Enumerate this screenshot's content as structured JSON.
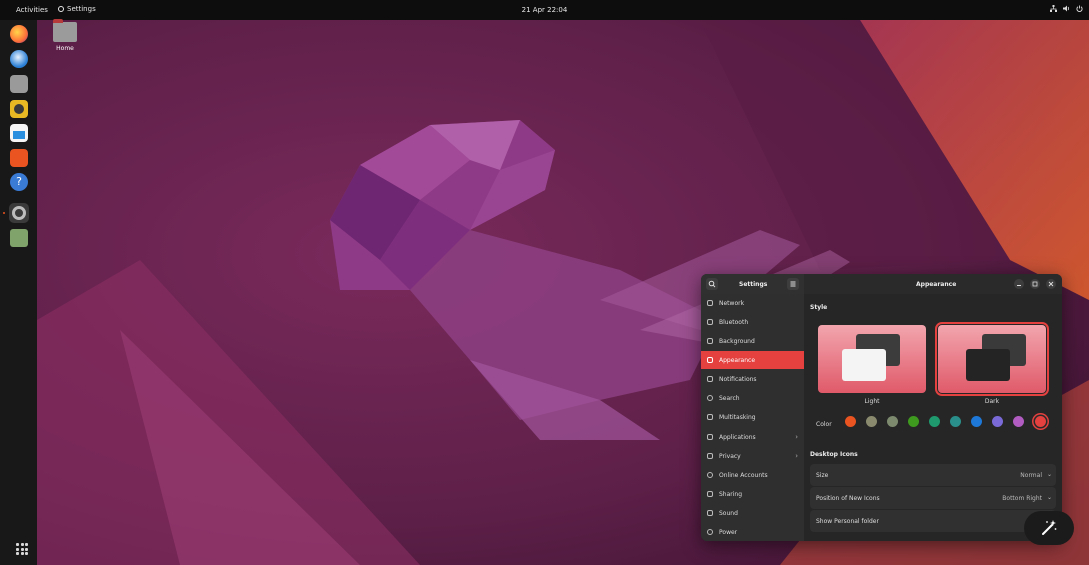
{
  "topbar": {
    "activities": "Activities",
    "app_menu": "Settings",
    "clock": "21 Apr  22:04"
  },
  "desktop": {
    "home_label": "Home"
  },
  "dock": {
    "items": [
      {
        "name": "firefox-icon",
        "color": "#ff7139"
      },
      {
        "name": "thunderbird-icon",
        "color": "#2a7fd5"
      },
      {
        "name": "files-icon",
        "color": "#9a9a9a"
      },
      {
        "name": "rhythmbox-icon",
        "color": "#e8b923"
      },
      {
        "name": "libreoffice-writer-icon",
        "color": "#2a8fde"
      },
      {
        "name": "ubuntu-software-icon",
        "color": "#e95420"
      },
      {
        "name": "help-icon",
        "color": "#3a7bd5"
      },
      {
        "name": "settings-icon",
        "color": "#8a8a8a"
      },
      {
        "name": "trash-icon",
        "color": "#7fa36a"
      }
    ]
  },
  "settings": {
    "sidebar_title": "Settings",
    "main_title": "Appearance",
    "sidebar_items": [
      {
        "label": "Network"
      },
      {
        "label": "Bluetooth"
      },
      {
        "label": "Background"
      },
      {
        "label": "Appearance",
        "selected": true
      },
      {
        "label": "Notifications"
      },
      {
        "label": "Search"
      },
      {
        "label": "Multitasking"
      },
      {
        "label": "Applications",
        "arrow": true
      },
      {
        "label": "Privacy",
        "arrow": true
      },
      {
        "label": "Online Accounts"
      },
      {
        "label": "Sharing"
      },
      {
        "label": "Sound"
      },
      {
        "label": "Power"
      }
    ],
    "style": {
      "title": "Style",
      "light_label": "Light",
      "dark_label": "Dark",
      "selected": "Dark"
    },
    "color": {
      "label": "Color",
      "swatches": [
        "#e95420",
        "#8a8b6e",
        "#7d8a6e",
        "#3e9a1f",
        "#1e9a6e",
        "#2a8f8a",
        "#1d78d8",
        "#7a6ad8",
        "#b05cc0",
        "#e4413f"
      ],
      "selected_index": 9
    },
    "desktop_icons": {
      "title": "Desktop Icons",
      "size_label": "Size",
      "size_value": "Normal",
      "position_label": "Position of New Icons",
      "position_value": "Bottom Right",
      "show_personal_label": "Show Personal folder",
      "show_personal_on": true
    }
  }
}
